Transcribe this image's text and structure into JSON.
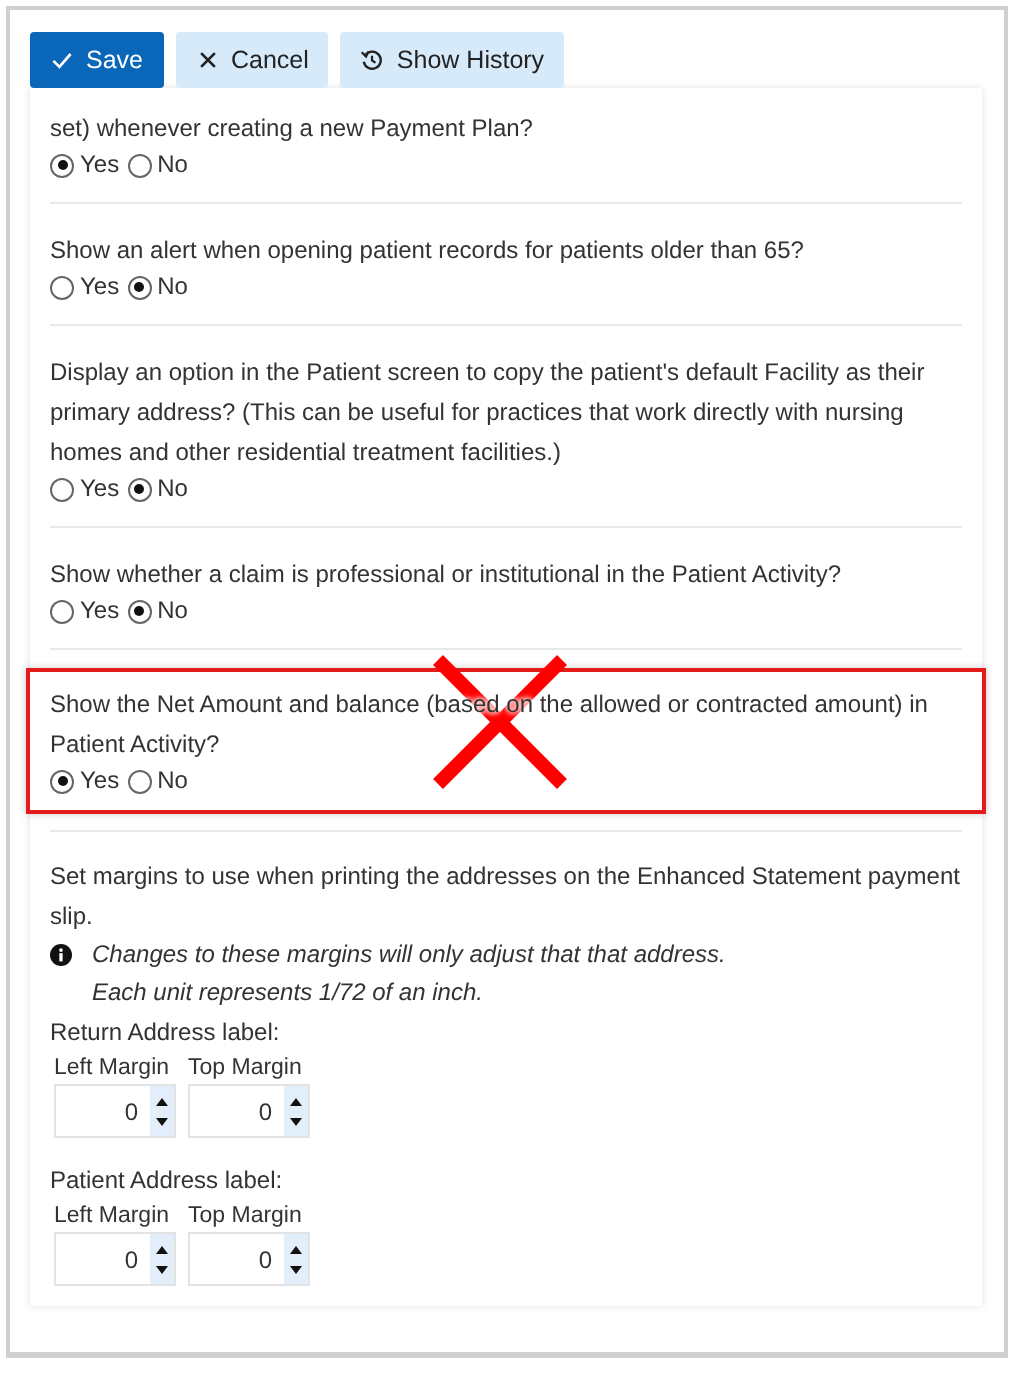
{
  "toolbar": [
    {
      "label": "Save",
      "kind": "save"
    },
    {
      "label": "Cancel",
      "kind": "cancel"
    },
    {
      "label": "Show History",
      "kind": "history"
    }
  ],
  "questions": [
    {
      "text": "set) whenever creating a new Payment Plan?",
      "highlighted": false,
      "crossed": false,
      "options": [
        {
          "label": "Yes",
          "selected": true
        },
        {
          "label": "No",
          "selected": false
        }
      ]
    },
    {
      "text": "Show an alert when opening patient records for patients older than 65?",
      "highlighted": false,
      "crossed": false,
      "options": [
        {
          "label": "Yes",
          "selected": false
        },
        {
          "label": "No",
          "selected": true
        }
      ]
    },
    {
      "text": "Display an option in the Patient screen to copy the patient's default Facility as their primary address? (This can be useful for practices that work directly with nursing homes and other residential treatment facilities.)",
      "highlighted": false,
      "crossed": false,
      "options": [
        {
          "label": "Yes",
          "selected": false
        },
        {
          "label": "No",
          "selected": true
        }
      ]
    },
    {
      "text": "Show whether a claim is professional or institutional in the Patient Activity?",
      "highlighted": false,
      "crossed": false,
      "options": [
        {
          "label": "Yes",
          "selected": false
        },
        {
          "label": "No",
          "selected": true
        }
      ]
    },
    {
      "text": "Show the Net Amount and balance (based on the allowed or contracted amount) in Patient Activity?",
      "highlighted": true,
      "crossed": true,
      "options": [
        {
          "label": "Yes",
          "selected": true
        },
        {
          "label": "No",
          "selected": false
        }
      ]
    }
  ],
  "margins": {
    "text": "Set margins to use when printing the addresses on the Enhanced Statement payment slip.",
    "notes": [
      "Changes to these margins will only adjust that that address.",
      "Each unit represents 1/72 of an inch."
    ],
    "groups": [
      {
        "label": "Return Address label:",
        "fields": [
          {
            "label": "Left Margin",
            "value": "0"
          },
          {
            "label": "Top Margin",
            "value": "0"
          }
        ]
      },
      {
        "label": "Patient Address label:",
        "fields": [
          {
            "label": "Left Margin",
            "value": "0"
          },
          {
            "label": "Top Margin",
            "value": "0"
          }
        ]
      }
    ]
  }
}
